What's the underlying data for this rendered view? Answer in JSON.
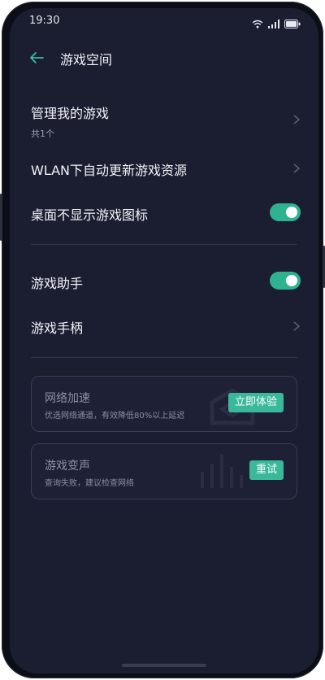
{
  "status": {
    "time": "19:30"
  },
  "header": {
    "title": "游戏空间"
  },
  "settings": {
    "manage": {
      "label": "管理我的游戏",
      "sub": "共1个"
    },
    "wlan": {
      "label": "WLAN下自动更新游戏资源"
    },
    "desktop_icon": {
      "label": "桌面不显示游戏图标",
      "enabled": true
    },
    "assistant": {
      "label": "游戏助手",
      "enabled": true
    },
    "controller": {
      "label": "游戏手柄"
    }
  },
  "cards": {
    "network": {
      "title": "网络加速",
      "desc": "优选网络通道，有效降低80%以上延迟",
      "button": "立即体验"
    },
    "voice": {
      "title": "游戏变声",
      "desc": "查询失败，建议检查网络",
      "button": "重试"
    }
  },
  "colors": {
    "accent": "#2fb28f",
    "background": "#1b1d31"
  }
}
